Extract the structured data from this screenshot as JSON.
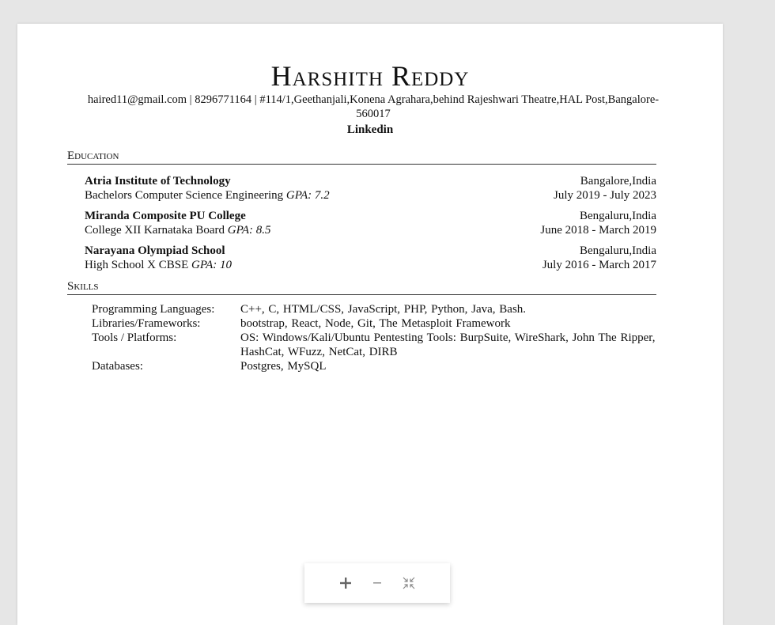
{
  "resume": {
    "name": "Harshith Reddy",
    "contact": "haired11@gmail.com | 8296771164 | #114/1,Geethanjali,Konena Agrahara,behind Rajeshwari Theatre,HAL Post,Bangalore-560017",
    "linkedin": "Linkedin"
  },
  "education": {
    "title": "Education",
    "entries": [
      {
        "school": "Atria Institute of Technology",
        "location": "Bangalore,India",
        "degree": "Bachelors Computer Science Engineering",
        "gpa": "GPA: 7.2",
        "dates": "July 2019 - July 2023"
      },
      {
        "school": "Miranda Composite PU College",
        "location": "Bengaluru,India",
        "degree": "College XII Karnataka Board",
        "gpa": "GPA: 8.5",
        "dates": "June 2018 - March 2019"
      },
      {
        "school": "Narayana Olympiad School",
        "location": "Bengaluru,India",
        "degree": "High School X CBSE",
        "gpa": "GPA: 10",
        "dates": "July 2016 - March 2017"
      }
    ]
  },
  "skills": {
    "title": "Skills",
    "rows": [
      {
        "label": "Programming Languages:",
        "value": "C++, C, HTML/CSS, JavaScript, PHP, Python, Java, Bash."
      },
      {
        "label": "Libraries/Frameworks:",
        "value": "bootstrap, React, Node, Git, The Metasploit Framework"
      },
      {
        "label": "Tools / Platforms:",
        "value": "OS: Windows/Kali/Ubuntu Pentesting Tools: BurpSuite, WireShark, John The Ripper, HashCat, WFuzz, NetCat, DIRB"
      },
      {
        "label": "Databases:",
        "value": "Postgres, MySQL"
      }
    ]
  },
  "viewer": {
    "zoom_in_icon": "plus-icon",
    "zoom_out_icon": "minus-icon",
    "fit_icon": "collapse-icon",
    "icon_color": "#666666"
  }
}
